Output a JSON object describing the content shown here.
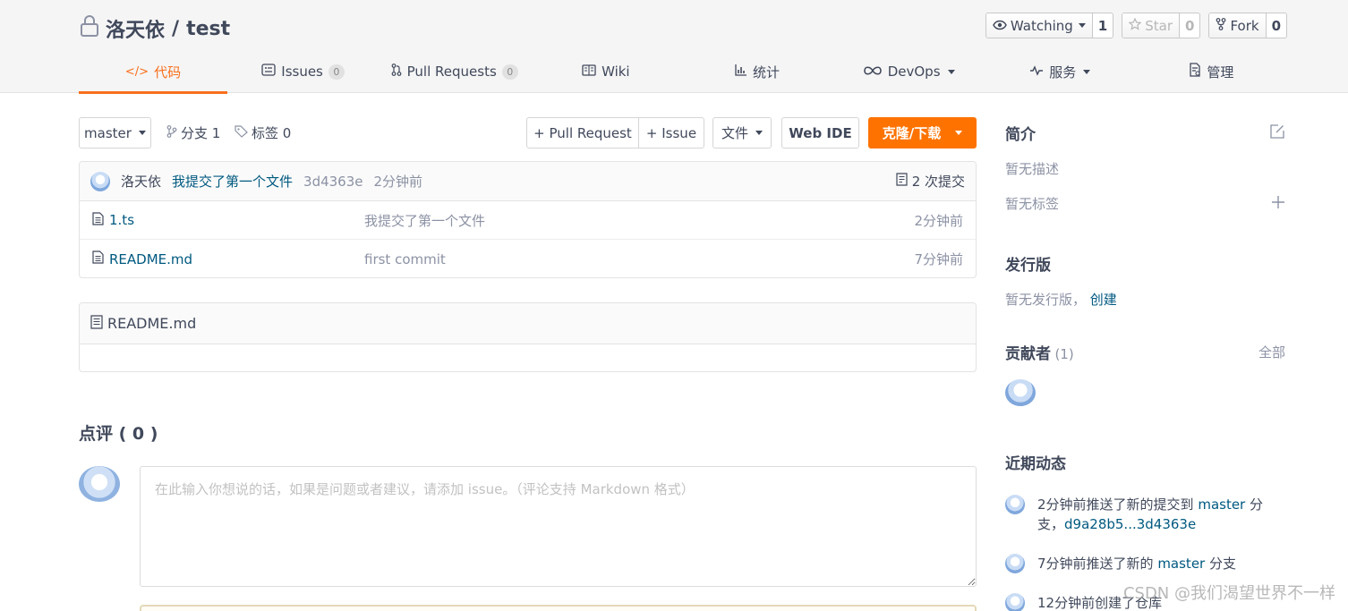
{
  "header": {
    "owner": "洛天依",
    "separator": "/",
    "repo": "test",
    "watch": {
      "label": "Watching",
      "count": "1"
    },
    "star": {
      "label": "Star",
      "count": "0"
    },
    "fork": {
      "label": "Fork",
      "count": "0"
    }
  },
  "tabs": [
    {
      "label": "代码",
      "icon": "code-icon",
      "active": true
    },
    {
      "label": "Issues",
      "badge": "0",
      "icon": "issues-icon"
    },
    {
      "label": "Pull Requests",
      "badge": "0",
      "icon": "pull-request-icon"
    },
    {
      "label": "Wiki",
      "icon": "wiki-icon"
    },
    {
      "label": "统计",
      "icon": "chart-icon"
    },
    {
      "label": "DevOps",
      "icon": "infinity-icon",
      "dropdown": true
    },
    {
      "label": "服务",
      "icon": "pulse-icon",
      "dropdown": true
    },
    {
      "label": "管理",
      "icon": "settings-doc-icon"
    }
  ],
  "toolbar": {
    "branch": "master",
    "branches": "分支 1",
    "tags": "标签 0",
    "pull_request": "+ Pull Request",
    "issue": "+ Issue",
    "file": "文件",
    "web_ide": "Web IDE",
    "clone": "克隆/下载"
  },
  "commit": {
    "author": "洛天依",
    "message": "我提交了第一个文件",
    "sha": "3d4363e",
    "time": "2分钟前",
    "count": "2 次提交"
  },
  "files": [
    {
      "name": "1.ts",
      "message": "我提交了第一个文件",
      "time": "2分钟前"
    },
    {
      "name": "README.md",
      "message": "first commit",
      "time": "7分钟前"
    }
  ],
  "readme": {
    "title": "README.md"
  },
  "comments": {
    "title": "点评 ( 0 )",
    "placeholder": "在此输入你想说的话，如果是问题或者建议，请添加 issue。（评论支持 Markdown 格式）"
  },
  "sidebar": {
    "intro_title": "简介",
    "no_desc": "暂无描述",
    "no_tags": "暂无标签",
    "release_title": "发行版",
    "no_release": "暂无发行版，",
    "create": "创建",
    "contributors_title": "贡献者",
    "contributors_count": "(1)",
    "all": "全部",
    "activity_title": "近期动态",
    "activity": [
      {
        "pre": "2分钟前推送了新的提交到 ",
        "branch": "master",
        "mid": " 分支，",
        "range": "d9a28b5...3d4363e"
      },
      {
        "pre": "7分钟前推送了新的 ",
        "branch": "master",
        "mid": " 分支",
        "range": ""
      },
      {
        "pre": "12分钟前创建了仓库",
        "branch": "",
        "mid": "",
        "range": ""
      }
    ]
  },
  "watermark": "CSDN @我们渴望世界不一样",
  "colors": {
    "accent": "#f86f1d",
    "button_orange": "#fe7300",
    "link": "#005980"
  }
}
